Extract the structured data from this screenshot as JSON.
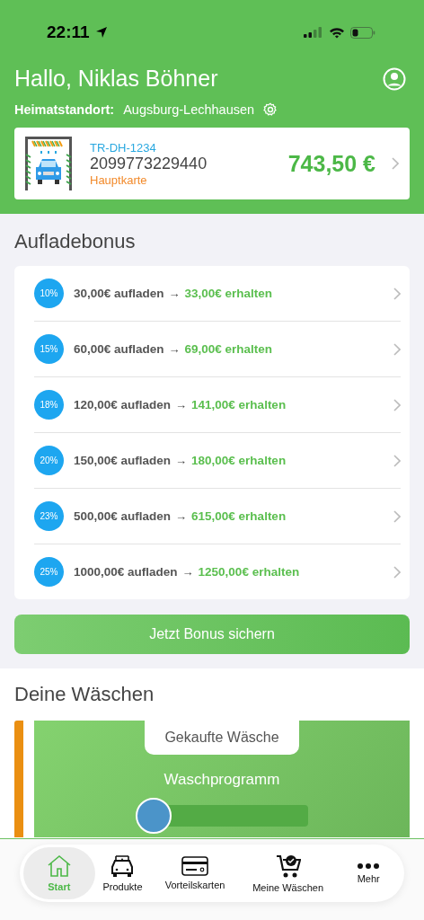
{
  "status_bar": {
    "time": "22:11"
  },
  "header": {
    "greeting": "Hallo, Niklas Böhner",
    "home_label": "Heimatstandort:",
    "home_location": "Augsburg-Lechhausen"
  },
  "card": {
    "plate": "TR-DH-1234",
    "number": "2099773229440",
    "card_type": "Hauptkarte",
    "balance": "743,50 €"
  },
  "bonus": {
    "title": "Aufladebonus",
    "offers": [
      {
        "percent": "10%",
        "topup": "30,00€ aufladen",
        "arrow": "→",
        "receive": "33,00€ erhalten"
      },
      {
        "percent": "15%",
        "topup": "60,00€ aufladen",
        "arrow": "→",
        "receive": "69,00€ erhalten"
      },
      {
        "percent": "18%",
        "topup": "120,00€ aufladen",
        "arrow": "→",
        "receive": "141,00€ erhalten"
      },
      {
        "percent": "20%",
        "topup": "150,00€ aufladen",
        "arrow": "→",
        "receive": "180,00€ erhalten"
      },
      {
        "percent": "23%",
        "topup": "500,00€ aufladen",
        "arrow": "→",
        "receive": "615,00€ erhalten"
      },
      {
        "percent": "25%",
        "topup": "1000,00€ aufladen",
        "arrow": "→",
        "receive": "1250,00€ erhalten"
      }
    ],
    "button": "Jetzt Bonus sichern"
  },
  "washes": {
    "title": "Deine Wäschen",
    "tab": "Gekaufte Wäsche",
    "program": "Waschprogramm"
  },
  "nav": [
    {
      "kind": "home",
      "label": "Start",
      "selected": true
    },
    {
      "kind": "car",
      "label": "Produkte",
      "selected": false
    },
    {
      "kind": "card",
      "label": "Vorteilskarten",
      "selected": false
    },
    {
      "kind": "cart",
      "label": "Meine Wäschen",
      "selected": false
    },
    {
      "kind": "more",
      "label": "Mehr",
      "selected": false
    }
  ]
}
